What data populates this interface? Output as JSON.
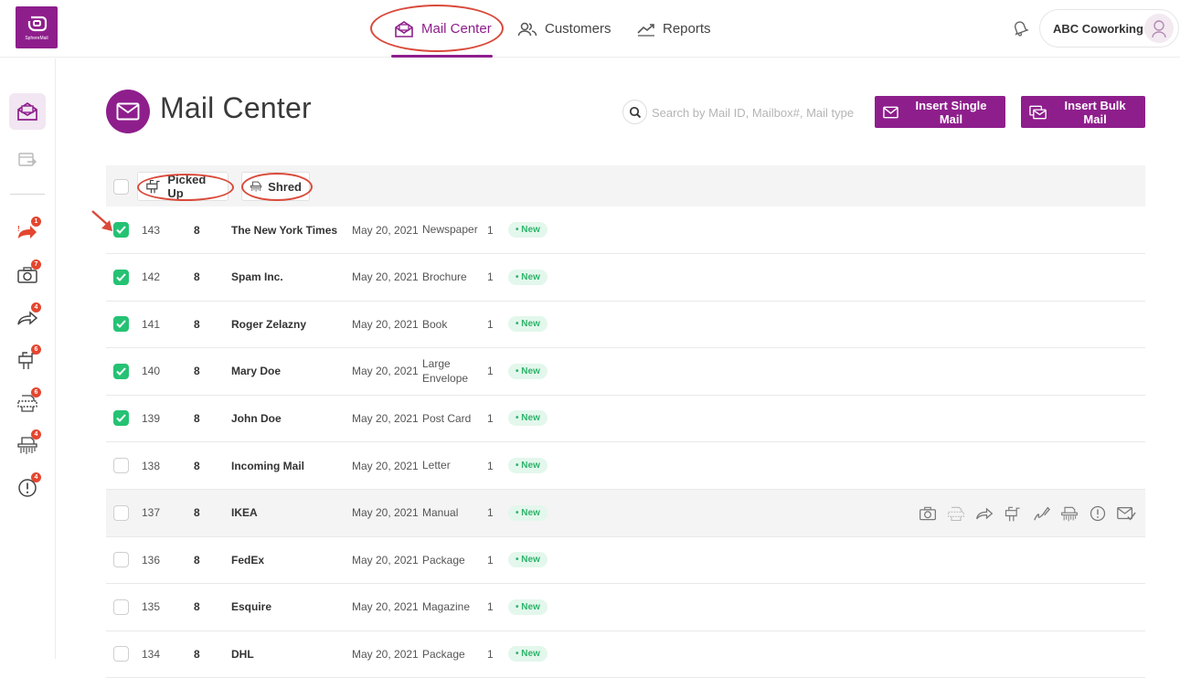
{
  "brand": {
    "logo_text": "SphereMail"
  },
  "nav": {
    "items": [
      {
        "label": "Mail Center",
        "icon": "envelope-open-icon",
        "active": true
      },
      {
        "label": "Customers",
        "icon": "users-icon",
        "active": false
      },
      {
        "label": "Reports",
        "icon": "trend-line-icon",
        "active": false
      }
    ]
  },
  "account": {
    "name": "ABC Coworking"
  },
  "sidebar": {
    "items": [
      {
        "icon": "mail-center-icon",
        "active": true,
        "badge": ""
      },
      {
        "icon": "inbox-forward-icon",
        "active": false,
        "badge": ""
      },
      {
        "icon": "urgent-forward-icon",
        "active": false,
        "badge": "1"
      },
      {
        "icon": "camera-icon",
        "active": false,
        "badge": "7"
      },
      {
        "icon": "forward-icon",
        "active": false,
        "badge": "4"
      },
      {
        "icon": "mailbox-icon",
        "active": false,
        "badge": "6"
      },
      {
        "icon": "scan-icon",
        "active": false,
        "badge": "6"
      },
      {
        "icon": "shred-icon",
        "active": false,
        "badge": "4"
      },
      {
        "icon": "alert-icon",
        "active": false,
        "badge": "4"
      }
    ]
  },
  "page": {
    "title": "Mail Center",
    "search_placeholder": "Search by Mail ID, Mailbox#, Mail type",
    "insert_single_label": "Insert Single Mail",
    "insert_bulk_label": "Insert Bulk Mail"
  },
  "toolbar": {
    "picked_up_label": "Picked Up",
    "shred_label": "Shred"
  },
  "mail_rows": [
    {
      "id": "143",
      "mailbox": "8",
      "sender": "The New York Times",
      "date": "May 20, 2021",
      "type": "Newspaper",
      "qty": "1",
      "status": "• New",
      "checked": true
    },
    {
      "id": "142",
      "mailbox": "8",
      "sender": "Spam Inc.",
      "date": "May 20, 2021",
      "type": "Brochure",
      "qty": "1",
      "status": "• New",
      "checked": true
    },
    {
      "id": "141",
      "mailbox": "8",
      "sender": "Roger Zelazny",
      "date": "May 20, 2021",
      "type": "Book",
      "qty": "1",
      "status": "• New",
      "checked": true
    },
    {
      "id": "140",
      "mailbox": "8",
      "sender": "Mary Doe",
      "date": "May 20, 2021",
      "type": "Large Envelope",
      "qty": "1",
      "status": "• New",
      "checked": true
    },
    {
      "id": "139",
      "mailbox": "8",
      "sender": "John Doe",
      "date": "May 20, 2021",
      "type": "Post Card",
      "qty": "1",
      "status": "• New",
      "checked": true
    },
    {
      "id": "138",
      "mailbox": "8",
      "sender": "Incoming Mail",
      "date": "May 20, 2021",
      "type": "Letter",
      "qty": "1",
      "status": "• New",
      "checked": false
    },
    {
      "id": "137",
      "mailbox": "8",
      "sender": "IKEA",
      "date": "May 20, 2021",
      "type": "Manual",
      "qty": "1",
      "status": "• New",
      "checked": false,
      "hovered": true
    },
    {
      "id": "136",
      "mailbox": "8",
      "sender": "FedEx",
      "date": "May 20, 2021",
      "type": "Package",
      "qty": "1",
      "status": "• New",
      "checked": false
    },
    {
      "id": "135",
      "mailbox": "8",
      "sender": "Esquire",
      "date": "May 20, 2021",
      "type": "Magazine",
      "qty": "1",
      "status": "• New",
      "checked": false
    },
    {
      "id": "134",
      "mailbox": "8",
      "sender": "DHL",
      "date": "May 20, 2021",
      "type": "Package",
      "qty": "1",
      "status": "• New",
      "checked": false
    }
  ],
  "row_actions": [
    "camera-icon",
    "scan-icon",
    "forward-icon",
    "mailbox-icon",
    "sign-icon",
    "shred-icon",
    "alert-icon",
    "envelope-check-icon"
  ],
  "colors": {
    "brand": "#8e1e8c",
    "checked": "#25c274",
    "status_bg": "#e3f7ec",
    "status_text": "#2fb36b",
    "badge": "#e4462f",
    "annotation": "#d94a3a"
  }
}
